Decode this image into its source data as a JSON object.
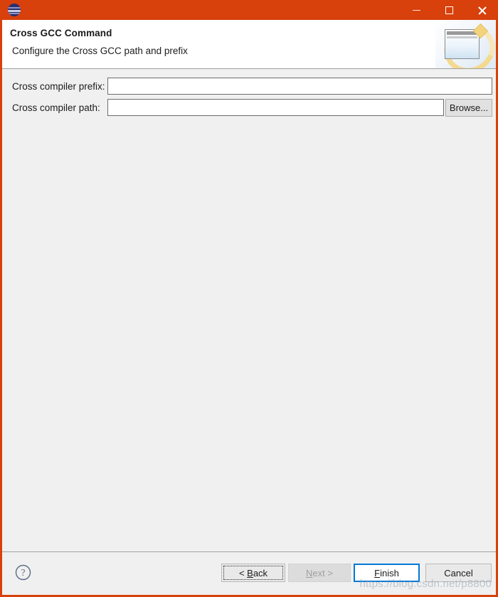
{
  "window": {
    "title": "",
    "accent_color": "#d8400c",
    "icon": "eclipse-icon",
    "controls": {
      "minimize": "minimize-icon",
      "maximize": "maximize-icon",
      "close": "close-icon"
    }
  },
  "header": {
    "title": "Cross GCC Command",
    "subtitle": "Configure the Cross GCC path and prefix",
    "banner_icon": "wizard-banner-icon"
  },
  "form": {
    "fields": [
      {
        "label": "Cross compiler prefix:",
        "value": "",
        "placeholder": ""
      },
      {
        "label": "Cross compiler path:",
        "value": "",
        "placeholder": ""
      }
    ],
    "browse_label": "Browse..."
  },
  "footer": {
    "help_icon": "help-icon",
    "buttons": {
      "back": {
        "prefix": "< ",
        "mnemonic": "B",
        "rest": "ack"
      },
      "next": {
        "mnemonic": "N",
        "rest": "ext",
        "suffix": " >"
      },
      "finish": {
        "mnemonic": "F",
        "rest": "inish"
      },
      "cancel": {
        "label": "Cancel"
      }
    }
  },
  "watermark": {
    "text": "https://blog.csdn.net/p8800"
  },
  "colors": {
    "titlebar": "#d8400c",
    "body": "#f0f0f0",
    "header_bg": "#ffffff",
    "default_button_border": "#0078d7",
    "disabled_text": "#a0a0a0"
  }
}
